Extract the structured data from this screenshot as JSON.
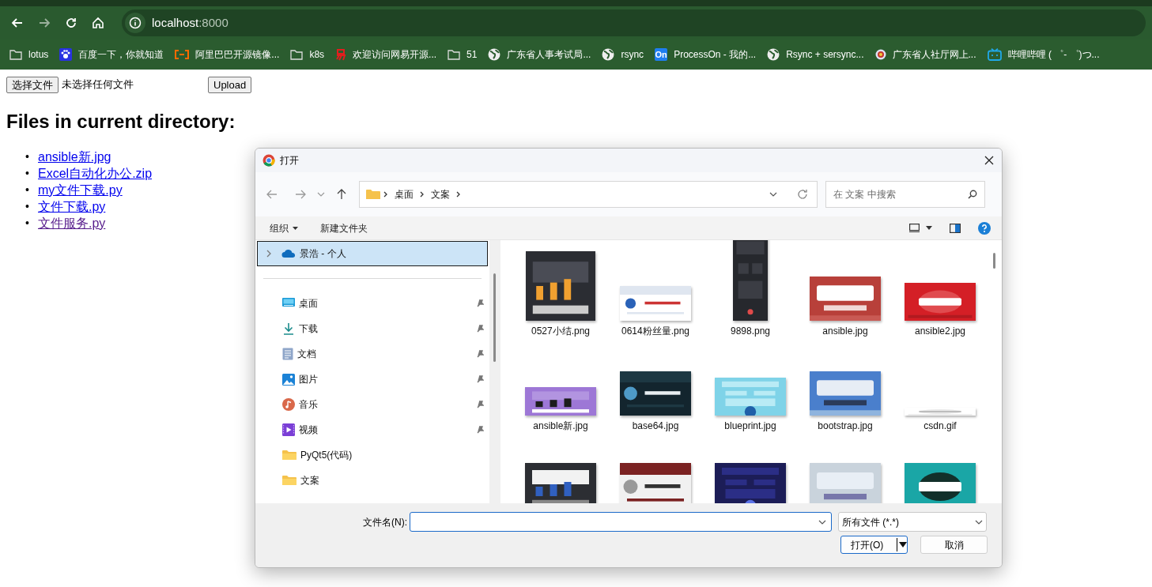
{
  "browser": {
    "url_host": "localhost",
    "url_port": ":8000",
    "bookmarks": [
      {
        "kind": "folder",
        "label": "lotus"
      },
      {
        "kind": "paw",
        "label": "百度一下，你就知道"
      },
      {
        "kind": "bracket",
        "label": "阿里巴巴开源镜像..."
      },
      {
        "kind": "folder",
        "label": "k8s"
      },
      {
        "kind": "red",
        "label": "欢迎访问网易开源..."
      },
      {
        "kind": "folder",
        "label": "51"
      },
      {
        "kind": "globe",
        "label": "广东省人事考试局..."
      },
      {
        "kind": "globe",
        "label": "rsync"
      },
      {
        "kind": "badge",
        "badge": "On",
        "label": "ProcessOn - 我的..."
      },
      {
        "kind": "globe",
        "label": "Rsync + sersync..."
      },
      {
        "kind": "emblem",
        "label": "广东省人社厅网上..."
      },
      {
        "kind": "tv",
        "label": "哔哩哔哩 ( ゜- ゜)つ..."
      }
    ]
  },
  "page": {
    "bullet": "•",
    "choose_button": "选择文件",
    "no_file": "未选择任何文件",
    "upload_button": "Upload",
    "heading": "Files in current directory:",
    "files": [
      {
        "name": "ansible新.jpg",
        "visited": false
      },
      {
        "name": "Excel自动化办公.zip",
        "visited": false
      },
      {
        "name": "my文件下载.py",
        "visited": false
      },
      {
        "name": "文件下载.py",
        "visited": false
      },
      {
        "name": "文件服务.py",
        "visited": true
      }
    ]
  },
  "dialog": {
    "title": "打开",
    "breadcrumb": [
      "桌面",
      "文案"
    ],
    "search_placeholder": "在 文案 中搜索",
    "organize": "组织",
    "new_folder": "新建文件夹",
    "sidebar": [
      {
        "kind": "cloud",
        "label": "景浩 - 个人",
        "selected": true,
        "pinned": false
      },
      {
        "kind": "desktop",
        "label": "桌面",
        "selected": false,
        "pinned": true
      },
      {
        "kind": "download",
        "label": "下载",
        "selected": false,
        "pinned": true
      },
      {
        "kind": "docs",
        "label": "文档",
        "selected": false,
        "pinned": true
      },
      {
        "kind": "pictures",
        "label": "图片",
        "selected": false,
        "pinned": true
      },
      {
        "kind": "music",
        "label": "音乐",
        "selected": false,
        "pinned": true
      },
      {
        "kind": "video",
        "label": "视频",
        "selected": false,
        "pinned": true
      },
      {
        "kind": "folder",
        "label": "PyQt5(代码)",
        "selected": false,
        "pinned": false
      },
      {
        "kind": "folder",
        "label": "文案",
        "selected": false,
        "pinned": false
      }
    ],
    "files": [
      {
        "kind": "picture",
        "name": "0527小结.png"
      },
      {
        "kind": "picture",
        "name": "0614粉丝量.png"
      },
      {
        "kind": "picture",
        "name": "9898.png"
      },
      {
        "kind": "picture",
        "name": "ansible.jpg"
      },
      {
        "kind": "picture",
        "name": "ansible2.jpg"
      },
      {
        "kind": "picture",
        "name": "ansible新.jpg"
      },
      {
        "kind": "picture",
        "name": "base64.jpg"
      },
      {
        "kind": "picture",
        "name": "blueprint.jpg"
      },
      {
        "kind": "picture",
        "name": "bootstrap.jpg"
      },
      {
        "kind": "picture",
        "name": "csdn.gif"
      },
      {
        "kind": "picture"
      },
      {
        "kind": "picture"
      },
      {
        "kind": "picture"
      },
      {
        "kind": "picture"
      },
      {
        "kind": "picture"
      }
    ],
    "filename_label": "文件名(N):",
    "filter": "所有文件 (*.*)",
    "open_button": "打开(O)",
    "cancel_button": "取消"
  }
}
